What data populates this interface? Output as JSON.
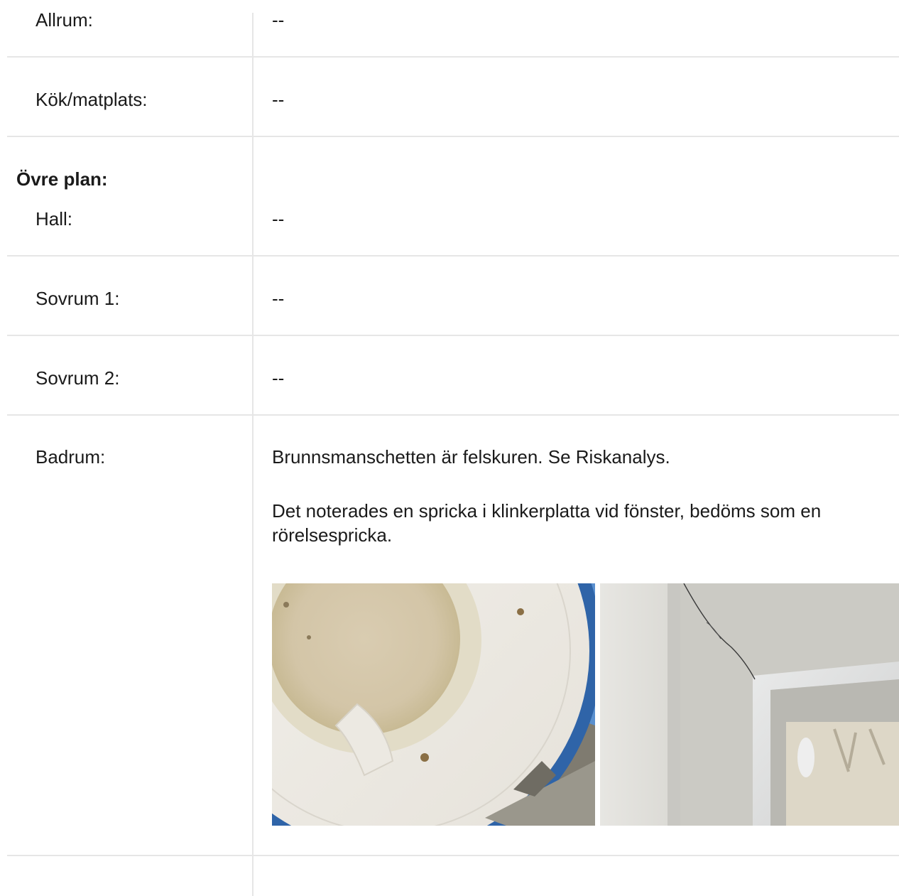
{
  "rows": [
    {
      "label": "Allrum:",
      "value": "--"
    },
    {
      "label": "Kök/matplats:",
      "value": "--"
    }
  ],
  "upper_floor": {
    "heading": "Övre plan:",
    "rows": [
      {
        "label": "Hall:",
        "value": "--"
      },
      {
        "label": "Sovrum 1:",
        "value": "--"
      },
      {
        "label": "Sovrum 2:",
        "value": "--"
      }
    ],
    "bathroom": {
      "label": "Badrum:",
      "paragraphs": [
        "Brunnsmanschetten är felskuren. Se Riskanalys.",
        "Det noterades en spricka i klinkerplatta vid fönster, bedöms som en rörelsespricka."
      ]
    }
  }
}
